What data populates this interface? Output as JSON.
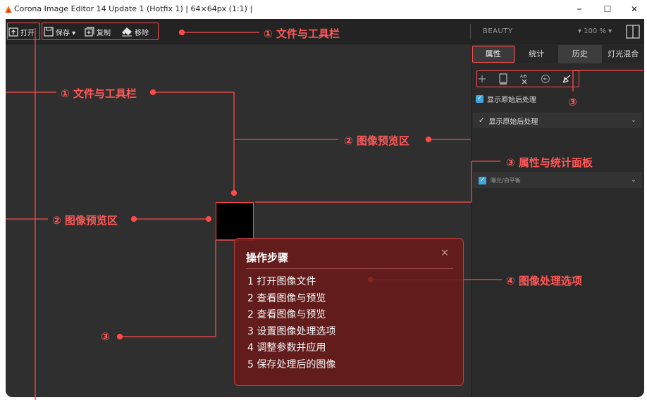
{
  "window": {
    "title": "Corona Image Editor 14 Update 1 (Hotfix 1) | 64×64px (1:1) |",
    "minimize": "–",
    "maximize": "☐",
    "close": "✕"
  },
  "toolbar": {
    "open_label": "打开",
    "save_label": "保存 ▾",
    "copy_label": "复制",
    "remove_label": "移除",
    "preset": "BEAUTY",
    "zoom": "▾  100 % ▾"
  },
  "panel": {
    "tabs": [
      "属性",
      "统计",
      "历史",
      "灯光混合"
    ],
    "show_original_label": "显示原始后处理",
    "section1_label": "显示原始后处理",
    "section2_label": "曝光/白平衡"
  },
  "annotations": {
    "callout_toolbar": "① 文件与工具栏",
    "callout_toolbar_left": "① 文件与工具栏",
    "callout_preview": "② 图像预览区",
    "callout_preview_left": "② 图像预览区",
    "callout_panel": "③ 属性与统计面板",
    "callout_panel_icons": "③",
    "callout_marker_bottom": "③",
    "callout_processing": "④ 图像处理选项"
  },
  "steps_dialog": {
    "title": "操作步骤",
    "close": "×",
    "items": [
      "1 打开图像文件",
      "2 查看图像与预览",
      "2 查看图像与预览",
      "3 设置图像处理选项",
      "4 调整参数并应用",
      "5 保存处理后的图像"
    ]
  },
  "colors": {
    "accent": "#ff4a4a",
    "app_background": "#2e2e2e",
    "checkbox": "#3ea7e0"
  }
}
